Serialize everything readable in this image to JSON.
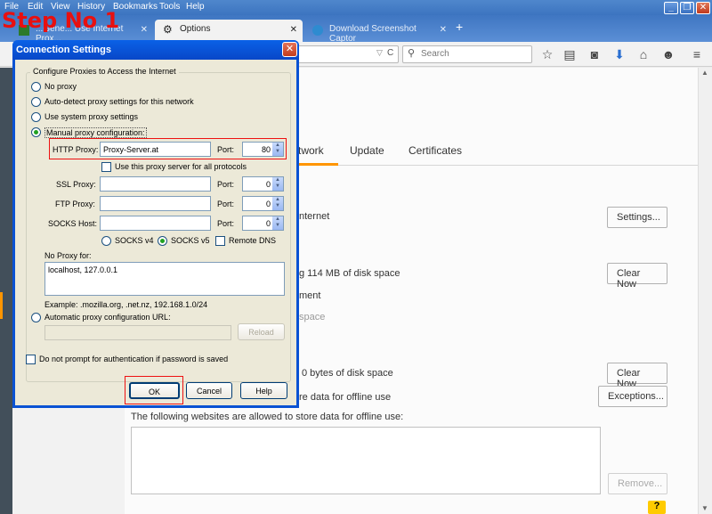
{
  "browser": {
    "menu": [
      "File",
      "Edit",
      "View",
      "History",
      "Bookmarks",
      "Tools",
      "Help"
    ],
    "window_buttons": {
      "minimize": "_",
      "restore": "❐",
      "close": "✕"
    },
    "tabs": [
      {
        "label": "...Gene... Use Internet Prox...",
        "close": "✕"
      },
      {
        "label": "Options",
        "close": "✕"
      },
      {
        "label": "Download Screenshot Captor",
        "close": "✕"
      }
    ],
    "new_tab": "+",
    "search_placeholder": "Search",
    "url_reload": "C"
  },
  "options_page": {
    "tabs": [
      "twork",
      "Update",
      "Certificates"
    ],
    "lines": {
      "internet": "nternet",
      "cache": "g 114 MB of disk space",
      "override": "ment",
      "space_grey": "space",
      "offline": "0 bytes of disk space",
      "store": "re data for offline use",
      "allowed": "The following websites are allowed to store data for offline use:"
    },
    "buttons": {
      "settings": "Settings...",
      "clear_now_1": "Clear Now",
      "clear_now_2": "Clear Now",
      "exceptions": "Exceptions...",
      "remove": "Remove..."
    },
    "help": "?"
  },
  "overlay": {
    "step_label": "Step No 1"
  },
  "dialog": {
    "title": "Connection Settings",
    "close": "✕",
    "group_label": "Configure Proxies to Access the Internet",
    "radio_no_proxy": "No proxy",
    "radio_auto_detect": "Auto-detect proxy settings for this network",
    "radio_system": "Use system proxy settings",
    "radio_manual": "Manual proxy configuration:",
    "http_label": "HTTP Proxy:",
    "http_value": "Proxy-Server.at",
    "port_label": "Port:",
    "http_port": "80",
    "same_proxy": "Use this proxy server for all protocols",
    "ssl_label": "SSL Proxy:",
    "ssl_port": "0",
    "ftp_label": "FTP Proxy:",
    "ftp_port": "0",
    "socks_label": "SOCKS Host:",
    "socks_port": "0",
    "socks_v4": "SOCKS v4",
    "socks_v5": "SOCKS v5",
    "remote_dns": "Remote DNS",
    "no_proxy_label": "No Proxy for:",
    "no_proxy_value": "localhost, 127.0.0.1",
    "example": "Example: .mozilla.org, .net.nz, 192.168.1.0/24",
    "radio_auto_url": "Automatic proxy configuration URL:",
    "reload": "Reload",
    "no_prompt": "Do not prompt for authentication if password is saved",
    "ok": "OK",
    "cancel": "Cancel",
    "help": "Help"
  }
}
